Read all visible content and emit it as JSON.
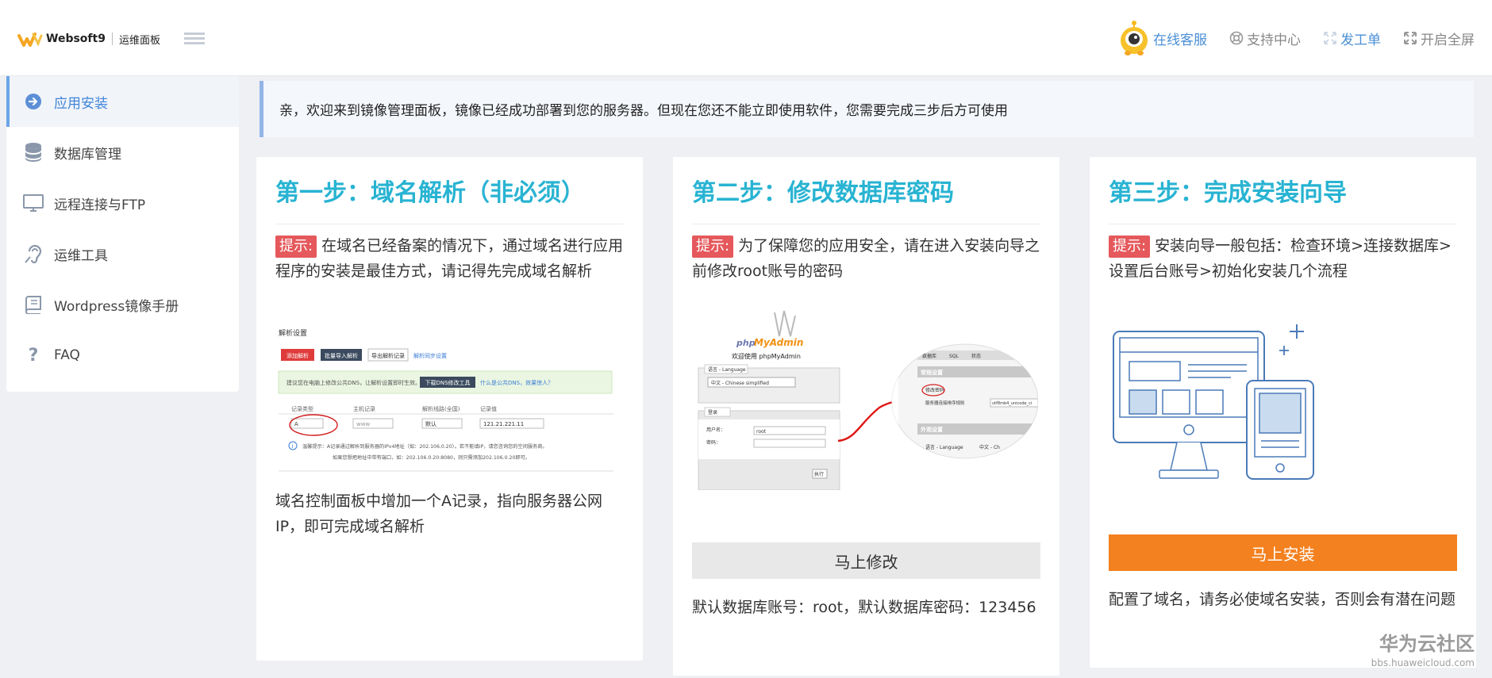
{
  "header": {
    "logo_text": "Websoft9",
    "logo_sub": "运维面板",
    "links": {
      "online_service": "在线客服",
      "support_center": "支持中心",
      "ticket": "发工单",
      "fullscreen": "开启全屏"
    }
  },
  "sidebar": {
    "items": [
      {
        "label": "应用安装",
        "icon": "arrow-circle-icon"
      },
      {
        "label": "数据库管理",
        "icon": "database-icon"
      },
      {
        "label": "远程连接与FTP",
        "icon": "monitor-icon"
      },
      {
        "label": "运维工具",
        "icon": "hearing-icon"
      },
      {
        "label": "Wordpress镜像手册",
        "icon": "book-icon"
      },
      {
        "label": "FAQ",
        "icon": "question-icon"
      }
    ]
  },
  "notice": "亲，欢迎来到镜像管理面板，镜像已经成功部署到您的服务器。但现在您还不能立即使用软件，您需要完成三步后方可使用",
  "steps": [
    {
      "title": "第一步：域名解析（非必须）",
      "tip_tag": "提示:",
      "tip": "在域名已经备案的情况下，通过域名进行应用程序的安装是最佳方式，请记得先完成域名解析",
      "footer": "域名控制面板中增加一个A记录，指向服务器公网IP，即可完成域名解析",
      "screenshot": {
        "title": "解析设置",
        "buttons": [
          "添加解析",
          "批量导入解析",
          "导出解析记录"
        ],
        "link": "解析同步设置",
        "banner": "建议您在电脑上修改公共DNS，让解析设置即时生效。",
        "banner_button": "下载DNS修改工具",
        "banner_link": "什么是公共DNS，效果惊人？",
        "columns": [
          "记录类型",
          "主机记录",
          "解析线路(全国)",
          "记录值"
        ],
        "row": [
          "A",
          "www",
          "默认",
          "121.21.221.11"
        ],
        "note_line1": "温馨提示：A记录通过解析到服务器的IPv4地址（如：202.106.0.20）。若不能填IP，请您咨询您的空间服务商。",
        "note_line2": "如果您想把地址中带有端口，如：202.106.0.20:8080，则只需添加202.106.0.20即可。"
      }
    },
    {
      "title": "第二步：修改数据库密码",
      "tip_tag": "提示:",
      "tip": "为了保障您的应用安全，请在进入安装向导之前修改root账号的密码",
      "button": "马上修改",
      "footer": "默认数据库账号：root，默认数据库密码：123456",
      "screenshot": {
        "logo_php": "php",
        "logo_my": "MyAdmin",
        "welcome": "欢迎使用 phpMyAdmin",
        "language": "语言 - Language",
        "lang_value": "中文 - Chinese simplified",
        "login": "登录",
        "user_label": "用户名：",
        "user_value": "root",
        "pass_label": "密码：",
        "exec": "执行",
        "right_tabs": [
          "数据库",
          "SQL",
          "状态"
        ],
        "general": "常规设置",
        "change_pw": "修改密码",
        "collation": "服务器连接排序规则",
        "collation_value": "utf8mb4_unicode_ci",
        "appearance": "外观设置",
        "lang2": "语言 - Language",
        "lang2_value": "中文 - Ch"
      }
    },
    {
      "title": "第三步：完成安装向导",
      "tip_tag": "提示:",
      "tip": "安装向导一般包括：检查环境>连接数据库>设置后台账号>初始化安装几个流程",
      "button": "马上安装",
      "footer": "配置了域名，请务必使域名安装，否则会有潜在问题"
    }
  ],
  "watermark": {
    "main": "华为云社区",
    "sub": "bbs.huaweicloud.com"
  },
  "colors": {
    "accent": "#28b3d2",
    "tip": "#e5585b",
    "orange": "#f4811f",
    "link": "#4a8fd6"
  }
}
